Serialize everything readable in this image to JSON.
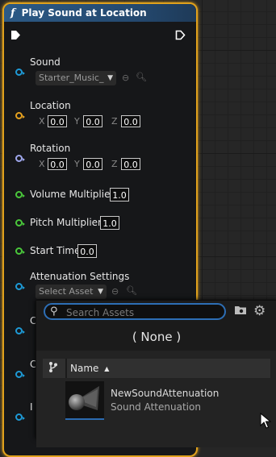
{
  "node": {
    "title": "Play Sound at Location",
    "fn_icon": "f",
    "pins": {
      "sound": {
        "label": "Sound",
        "asset": "Starter_Music_",
        "color": "#1e9ad6"
      },
      "location": {
        "label": "Location",
        "x_label": "X",
        "x": "0.0",
        "y_label": "Y",
        "y": "0.0",
        "z_label": "Z",
        "z": "0.0",
        "color": "#e5a11f"
      },
      "rotation": {
        "label": "Rotation",
        "x_label": "X",
        "x": "0.0",
        "y_label": "Y",
        "y": "0.0",
        "z_label": "Z",
        "z": "0.0",
        "color": "#9fa7ec"
      },
      "volume_multiplier": {
        "label": "Volume Multiplier",
        "value": "1.0",
        "color": "#4ac83b"
      },
      "pitch_multiplier": {
        "label": "Pitch Multiplier",
        "value": "1.0",
        "color": "#4ac83b"
      },
      "start_time": {
        "label": "Start Time",
        "value": "0.0",
        "color": "#4ac83b"
      },
      "attenuation_settings": {
        "label": "Attenuation Settings",
        "asset": "Select Asset",
        "color": "#1e9ad6"
      },
      "hidden_1": {
        "label": "C",
        "color": "#1e9ad6"
      },
      "hidden_2": {
        "label": "C",
        "color": "#1e9ad6"
      },
      "hidden_3": {
        "label": "I",
        "color": "#1e9ad6"
      }
    }
  },
  "picker": {
    "search_placeholder": "Search Assets",
    "none_option": "( None )",
    "column_name": "Name",
    "sort_glyph": "▲",
    "items": [
      {
        "name": "NewSoundAttenuation",
        "type": "Sound Attenuation"
      }
    ],
    "accent": "#2d6eb5"
  }
}
